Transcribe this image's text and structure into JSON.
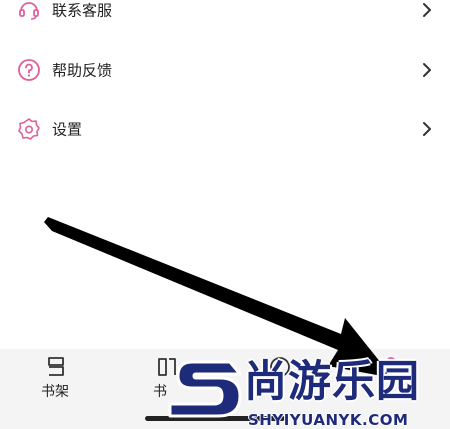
{
  "menu": {
    "items": [
      {
        "label": "联系客服",
        "icon": "headset-icon"
      },
      {
        "label": "帮助反馈",
        "icon": "help-icon"
      },
      {
        "label": "设置",
        "icon": "settings-icon"
      }
    ]
  },
  "tabbar": {
    "tabs": [
      {
        "label": "书架",
        "icon": "bookshelf-icon"
      },
      {
        "label": "书",
        "icon": "book-icon"
      }
    ]
  },
  "watermark": {
    "title": "尚游乐园",
    "url": "SHYIYUANYK.COM"
  },
  "colors": {
    "accent": "#e0609a",
    "watermark": "#1e2a7a"
  }
}
